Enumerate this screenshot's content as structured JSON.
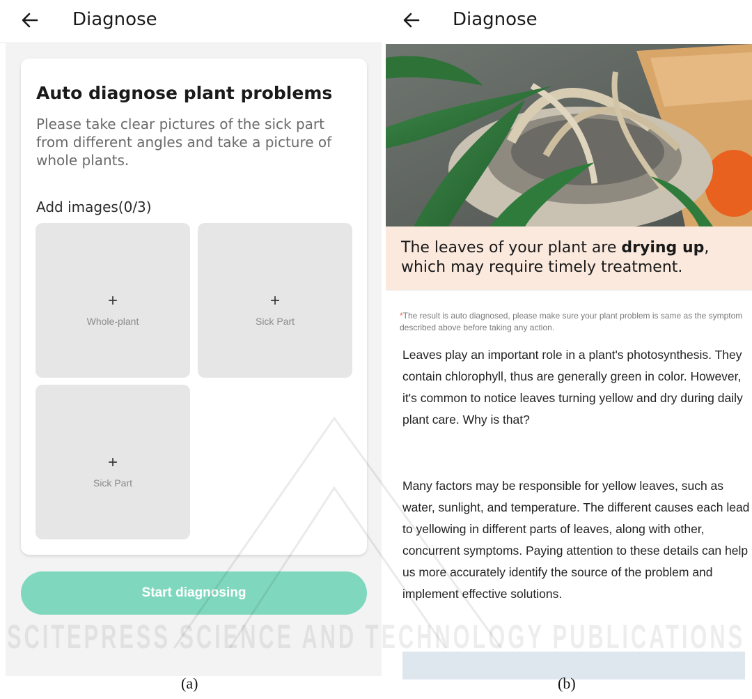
{
  "panel_a": {
    "header": {
      "title": "Diagnose"
    },
    "card": {
      "title": "Auto diagnose plant problems",
      "description": "Please take clear pictures of the sick part from different angles and take a picture of whole plants.",
      "add_images_label": "Add images(0/3)",
      "slots": [
        {
          "plus": "+",
          "label": "Whole-plant"
        },
        {
          "plus": "+",
          "label": "Sick Part"
        },
        {
          "plus": "+",
          "label": "Sick Part"
        }
      ]
    },
    "start_button_label": "Start diagnosing",
    "caption": "(a)"
  },
  "panel_b": {
    "header": {
      "title": "Diagnose"
    },
    "result": {
      "prefix": "The leaves of your plant are ",
      "emphasis": "drying up",
      "suffix": ", which may require timely treatment."
    },
    "note": {
      "star": "*",
      "text": "The result is auto diagnosed, please make sure your plant problem is same as the symptom described above before taking any action."
    },
    "paragraphs": [
      "Leaves play an important role in a plant's photosynthesis. They contain chlorophyll, thus are generally green in color. However, it's common to notice leaves turning yellow and dry during daily plant care. Why is that?",
      "Many factors may be responsible for yellow leaves, such as water, sunlight, and temperature. The different causes each lead to yellowing in different parts of leaves, along with other, concurrent symptoms. Paying attention to these details can help us more accurately identify the source of the problem and implement effective solutions."
    ],
    "caption": "(b)"
  },
  "watermark": {
    "text": "SCITEPRESS SCIENCE AND TECHNOLOGY PUBLICATIONS"
  },
  "colors": {
    "accent_button": "#7fd8be",
    "result_background": "#fbe9dd",
    "note_star": "#e8683e",
    "slot_background": "#e6e6e6"
  },
  "icons": {
    "back": "arrow-left-icon",
    "add": "plus-icon"
  }
}
